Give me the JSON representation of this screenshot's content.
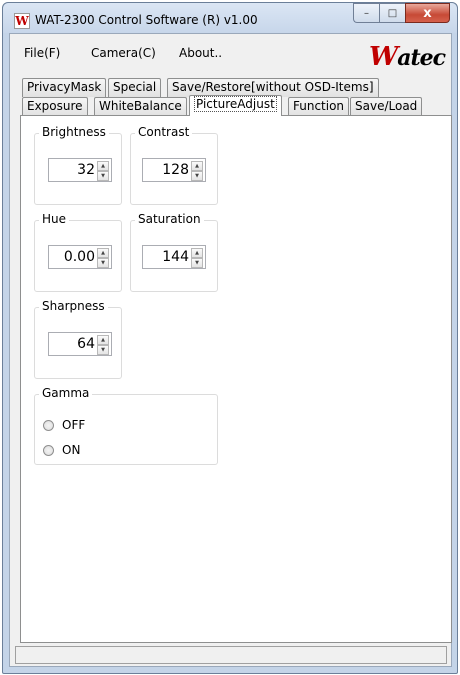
{
  "window": {
    "title": "WAT-2300 Control Software (R) v1.00",
    "icon_letter": "W",
    "caption_min": "–",
    "caption_max": "□",
    "caption_close": "x"
  },
  "menu": {
    "file_label": "File(F)",
    "camera_label": "Camera(C)",
    "about_label": "About.."
  },
  "logo": {
    "first": "W",
    "rest": "atec"
  },
  "tabs": {
    "row1": [
      {
        "label": "PrivacyMask"
      },
      {
        "label": "Special"
      },
      {
        "label": "Save/Restore[without OSD-Items]"
      }
    ],
    "row2": [
      {
        "label": "Exposure"
      },
      {
        "label": "WhiteBalance"
      },
      {
        "label": "PictureAdjust",
        "active": true
      },
      {
        "label": "Function"
      },
      {
        "label": "Save/Load"
      }
    ]
  },
  "picture_adjust": {
    "brightness": {
      "label": "Brightness",
      "value": "32"
    },
    "contrast": {
      "label": "Contrast",
      "value": "128"
    },
    "hue": {
      "label": "Hue",
      "value": "0.00"
    },
    "saturation": {
      "label": "Saturation",
      "value": "144"
    },
    "sharpness": {
      "label": "Sharpness",
      "value": "64"
    },
    "gamma": {
      "label": "Gamma",
      "options": [
        {
          "label": "OFF",
          "selected": false
        },
        {
          "label": "ON",
          "selected": false
        }
      ]
    }
  },
  "spinner": {
    "up": "▲",
    "down": "▼"
  },
  "status": {
    "text": ""
  }
}
